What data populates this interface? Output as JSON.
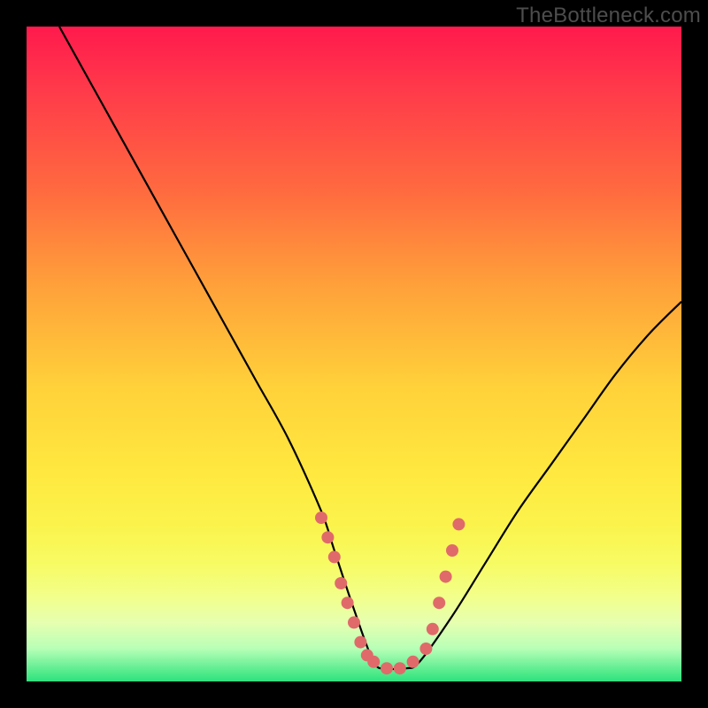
{
  "watermark": "TheBottleneck.com",
  "chart_data": {
    "type": "line",
    "title": "",
    "xlabel": "",
    "ylabel": "",
    "xlim": [
      0,
      100
    ],
    "ylim": [
      0,
      100
    ],
    "series": [
      {
        "name": "bottleneck-curve",
        "x": [
          5,
          10,
          15,
          20,
          25,
          30,
          35,
          40,
          45,
          47,
          50,
          53,
          55,
          58,
          60,
          65,
          70,
          75,
          80,
          85,
          90,
          95,
          100
        ],
        "y": [
          100,
          91,
          82,
          73,
          64,
          55,
          46,
          37,
          26,
          20,
          11,
          3,
          2,
          2,
          3,
          10,
          18,
          26,
          33,
          40,
          47,
          53,
          58
        ]
      }
    ],
    "markers": [
      {
        "x": 45,
        "y": 25
      },
      {
        "x": 46,
        "y": 22
      },
      {
        "x": 47,
        "y": 19
      },
      {
        "x": 48,
        "y": 15
      },
      {
        "x": 49,
        "y": 12
      },
      {
        "x": 50,
        "y": 9
      },
      {
        "x": 51,
        "y": 6
      },
      {
        "x": 52,
        "y": 4
      },
      {
        "x": 53,
        "y": 3
      },
      {
        "x": 55,
        "y": 2
      },
      {
        "x": 57,
        "y": 2
      },
      {
        "x": 59,
        "y": 3
      },
      {
        "x": 61,
        "y": 5
      },
      {
        "x": 62,
        "y": 8
      },
      {
        "x": 63,
        "y": 12
      },
      {
        "x": 64,
        "y": 16
      },
      {
        "x": 65,
        "y": 20
      },
      {
        "x": 66,
        "y": 24
      }
    ],
    "colors": {
      "curve": "#000000",
      "marker": "#e06a6a",
      "gradient_top": "#ff1a4d",
      "gradient_bottom": "#2fe07f"
    }
  }
}
